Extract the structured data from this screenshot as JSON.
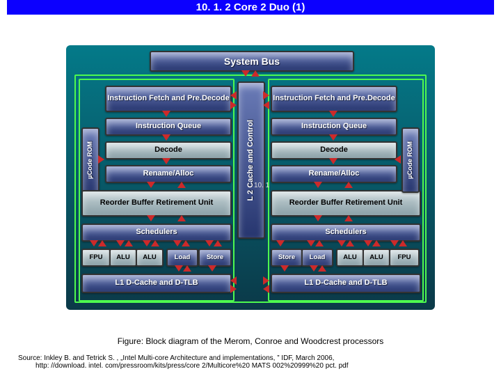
{
  "header": {
    "title": "10. 1. 2 Core 2 Duo (1)"
  },
  "pageNumber": "10. 1",
  "diagram": {
    "systemBus": "System Bus",
    "l2": "L 2 Cache and Control",
    "left": {
      "ucodeRom": "µCode ROM",
      "fetch": "Instruction Fetch and Pre.Decode",
      "iq": "Instruction Queue",
      "decode": "Decode",
      "rename": "Rename/Alloc",
      "rob": "Reorder Buffer Retirement Unit",
      "sched": "Schedulers",
      "exec": {
        "fpu": "FPU",
        "alu1": "ALU",
        "alu2": "ALU",
        "load": "Load",
        "store": "Store"
      },
      "l1": "L1 D-Cache and D-TLB"
    },
    "right": {
      "ucodeRom": "µCode ROM",
      "fetch": "Instruction Fetch and Pre.Decode",
      "iq": "Instruction Queue",
      "decode": "Decode",
      "rename": "Rename/Alloc",
      "rob": "Reorder Buffer Retirement Unit",
      "sched": "Schedulers",
      "exec": {
        "store": "Store",
        "load": "Load",
        "alu1": "ALU",
        "alu2": "ALU",
        "fpu": "FPU"
      },
      "l1": "L1 D-Cache and D-TLB"
    }
  },
  "caption": "Figure: Block diagram of the Merom, Conroe and Woodcrest processors",
  "source": {
    "line1": "Source: Inkley B. and Tetrick S. , „Intel Multi-core Architecture and implementations, ” IDF, March 2006,",
    "line2": "http: //download. intel. com/pressroom/kits/press/core 2/Multicore%20 MATS 002%20999%20 pct. pdf"
  }
}
